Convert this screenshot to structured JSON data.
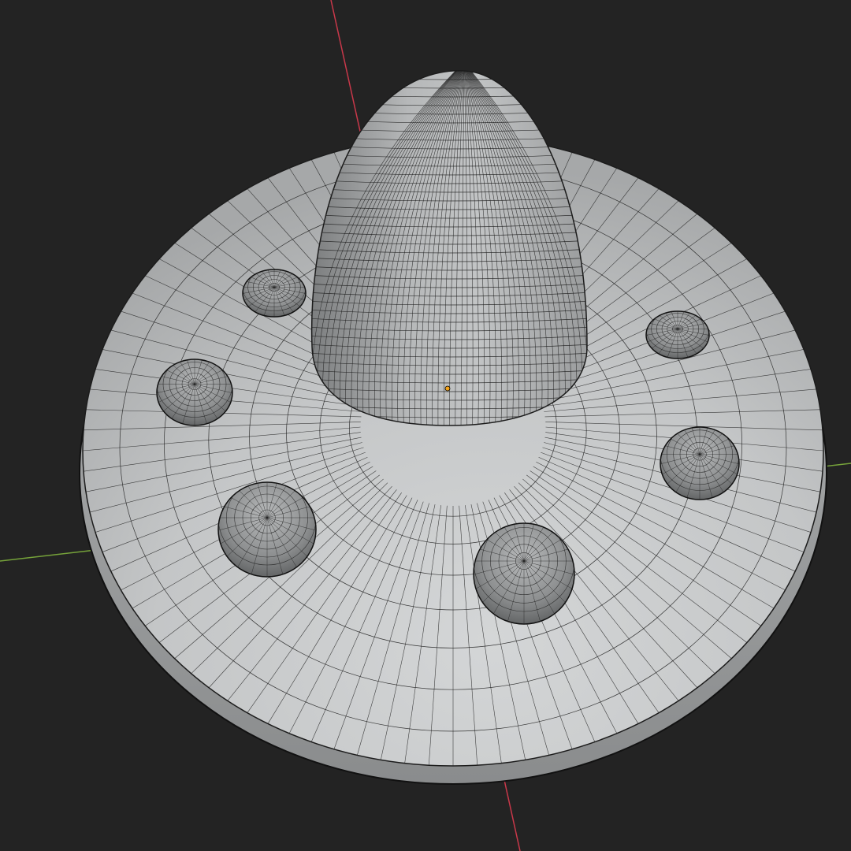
{
  "viewport": {
    "type": "3d-viewport",
    "shading": "solid-wireframe",
    "background_color": "#232323"
  },
  "axes": {
    "x_axis_color": "#c9384a",
    "y_axis_color": "#76a33a"
  },
  "origin": {
    "color": "#f2a21a"
  },
  "object": {
    "shape": "saucer-with-cone-dome",
    "surface_color": "#c9cbcc",
    "wire_color": "#1c1c1c",
    "dome_count": 7
  }
}
